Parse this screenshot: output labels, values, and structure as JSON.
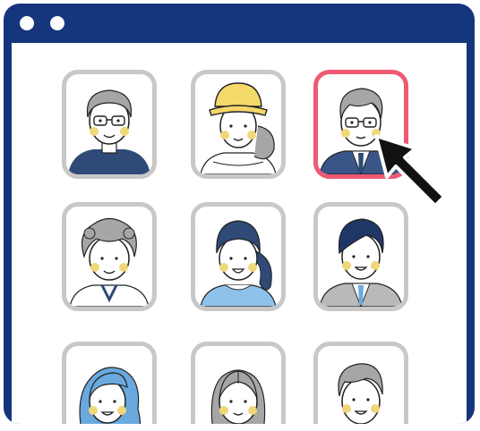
{
  "window": {
    "frame_color": "#15357d",
    "titlebar_icons": [
      "window-dot-icon",
      "window-dot-icon"
    ]
  },
  "avatars": [
    {
      "person": "glasses-man-sweater",
      "selected": false
    },
    {
      "person": "woman-yellow-hat",
      "selected": false
    },
    {
      "person": "businessman-glasses",
      "selected": true
    },
    {
      "person": "grandma-curly",
      "selected": false
    },
    {
      "person": "girl-ponytail",
      "selected": false
    },
    {
      "person": "young-businessman",
      "selected": false
    },
    {
      "person": "woman-blue-hair",
      "selected": false
    },
    {
      "person": "woman-gray-hair",
      "selected": false
    },
    {
      "person": "man-gray-hair",
      "selected": false
    }
  ],
  "colors": {
    "selected_border": "#ee5a73",
    "card_border": "#c8c8c8",
    "cheek": "#f0d77a",
    "navy": "#2f4a77",
    "blue_hair": "#6aa9de"
  },
  "cursor": {
    "icon": "pointer-arrow-icon"
  }
}
